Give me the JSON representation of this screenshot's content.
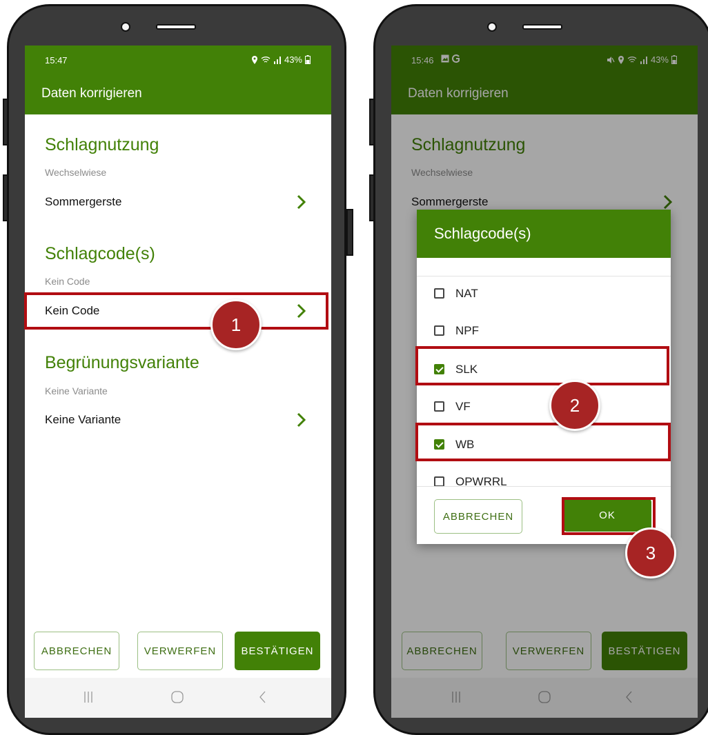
{
  "left_screen": {
    "status_time": "15:47",
    "status_right": "43%",
    "appbar_title": "Daten korrigieren",
    "sections": [
      {
        "title": "Schlagnutzung",
        "subtitle": "Wechselwiese",
        "value": "Sommergerste"
      },
      {
        "title": "Schlagcode(s)",
        "subtitle": "Kein Code",
        "value": "Kein Code"
      },
      {
        "title": "Begrünungsvariante",
        "subtitle": "Keine Variante",
        "value": "Keine Variante"
      }
    ],
    "buttons": {
      "cancel": "ABBRECHEN",
      "discard": "VERWERFEN",
      "confirm": "BESTÄTIGEN"
    }
  },
  "right_screen": {
    "status_time": "15:46",
    "status_right": "43%",
    "appbar_title": "Daten korrigieren",
    "background": {
      "sections": [
        {
          "title": "Schlagnutzung",
          "subtitle": "Wechselwiese",
          "value": "Sommergerste"
        }
      ]
    },
    "dialog": {
      "title": "Schlagcode(s)",
      "items": [
        {
          "label": "NAT",
          "checked": false
        },
        {
          "label": "NPF",
          "checked": false
        },
        {
          "label": "SLK",
          "checked": true
        },
        {
          "label": "VF",
          "checked": false
        },
        {
          "label": "WB",
          "checked": true
        },
        {
          "label": "OPWRRL",
          "checked": false
        }
      ],
      "cancel_label": "ABBRECHEN",
      "ok_label": "OK"
    },
    "buttons": {
      "cancel": "ABBRECHEN",
      "discard": "VERWERFEN",
      "confirm": "BESTÄTIGEN"
    }
  },
  "annotations": {
    "step1": "1",
    "step2": "2",
    "step3": "3"
  },
  "colors": {
    "primary_green": "#428107",
    "highlight_red": "#b10d12",
    "badge_red": "#a72424"
  }
}
